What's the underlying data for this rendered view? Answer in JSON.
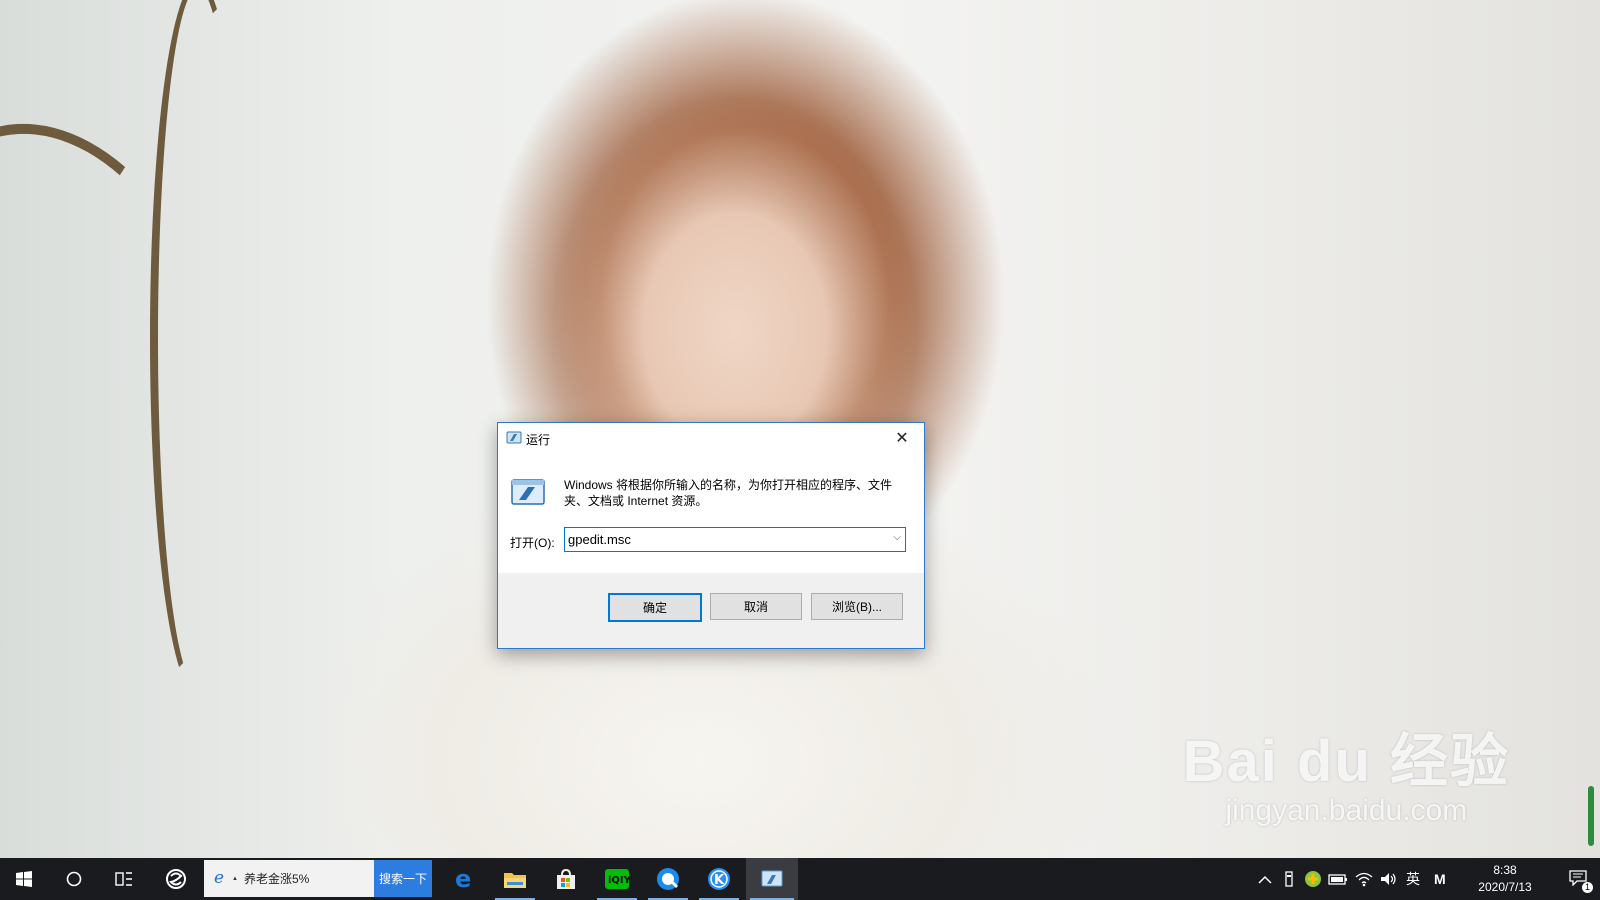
{
  "dialog": {
    "title": "运行",
    "description": "Windows 将根据你所输入的名称，为你打开相应的程序、文件夹、文档或 Internet 资源。",
    "open_label": "打开(O):",
    "input_value": "gpedit.msc",
    "ok_label": "确定",
    "cancel_label": "取消",
    "browse_label": "浏览(B)...",
    "close_icon": "close-icon"
  },
  "watermark": {
    "main": "Bai du 经验",
    "sub": "jingyan.baidu.com"
  },
  "taskbar": {
    "search_text": "养老金涨5%",
    "search_button": "搜索一下",
    "apps": [
      "start-icon",
      "cortana-icon",
      "task-view-icon",
      "app-icon",
      "edge-icon",
      "file-explorer-icon",
      "store-icon",
      "iqiyi-icon",
      "browser-icon",
      "kugou-icon",
      "run-icon"
    ],
    "ime": "英",
    "ime_mode": "M",
    "time": "8:38",
    "date": "2020/7/13",
    "notification_count": "1"
  },
  "colors": {
    "accent": "#0078d7",
    "taskbar": "#1a1b1e",
    "search_button": "#2d7de0"
  }
}
